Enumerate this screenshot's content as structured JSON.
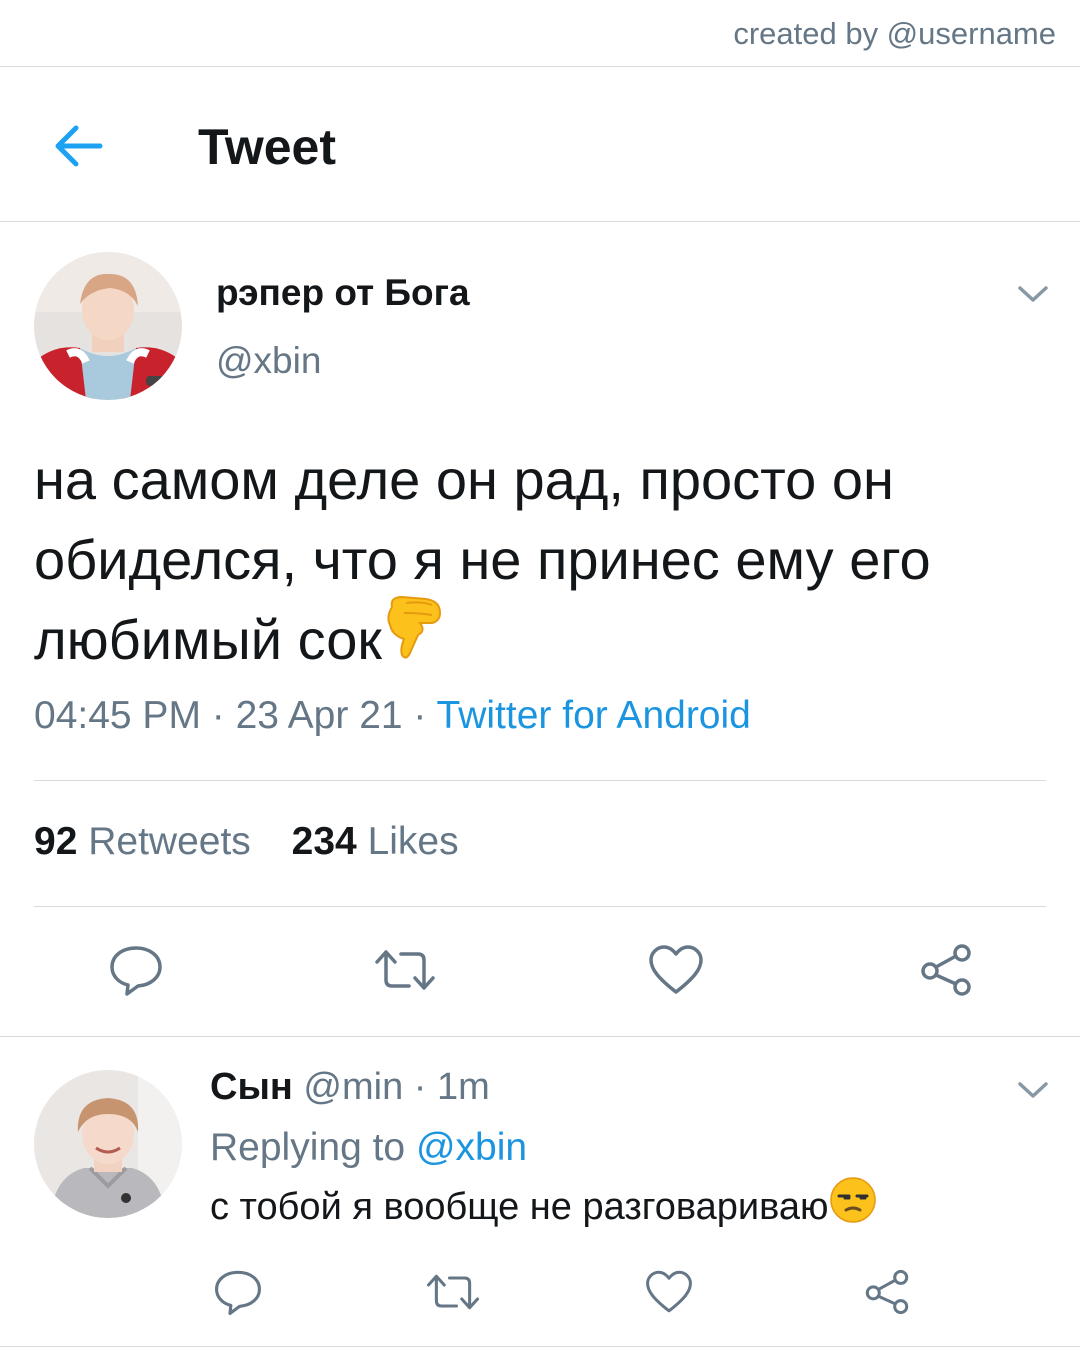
{
  "credit": "created by @username",
  "header": {
    "title": "Tweet",
    "back_icon": "arrow-left-icon"
  },
  "accent_color": "#1da1f2",
  "tweet": {
    "author_name": "рэпер от Бога",
    "author_handle": "@xbin",
    "text_parts": [
      "на самом деле он рад, просто он",
      "обиделся, что я не принес ему его",
      "любимый сок"
    ],
    "emoji_icon": "backhand-pointing-down-icon",
    "time": "04:45 PM",
    "date": "23 Apr 21",
    "source": "Twitter for Android",
    "retweets_count": "92",
    "retweets_label": "Retweets",
    "likes_count": "234",
    "likes_label": "Likes",
    "actions": [
      "reply-icon",
      "retweet-icon",
      "like-icon",
      "share-icon"
    ]
  },
  "reply": {
    "author_name": "Сын",
    "author_handle": "@min",
    "time": "1m",
    "replying_label": "Replying to",
    "replying_to": "@xbin",
    "text": "с тобой я вообще не разговариваю",
    "emoji_icon": "unamused-face-icon"
  }
}
